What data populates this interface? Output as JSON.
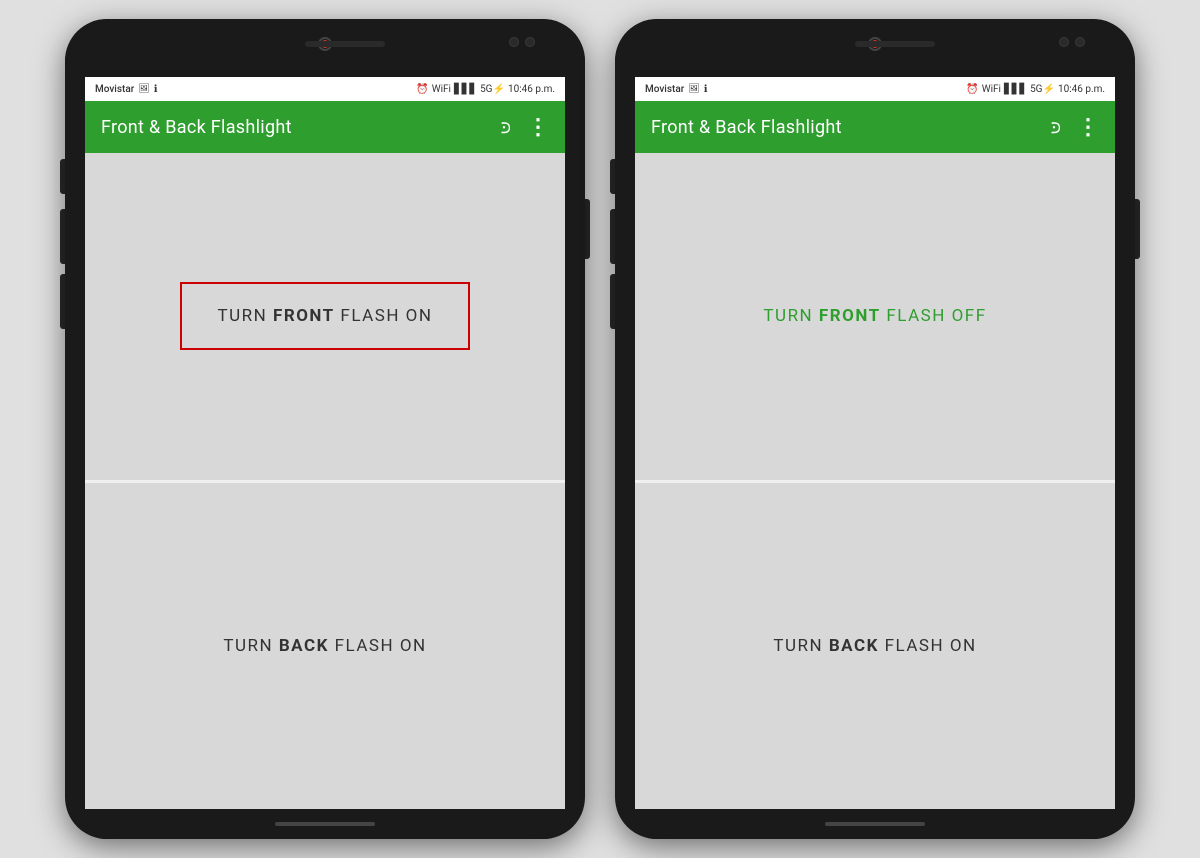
{
  "background_color": "#e0e0e0",
  "phones": [
    {
      "id": "phone-left",
      "carrier": "Movistar",
      "time": "10:46 p.m.",
      "app_title": "Front & Back Flashlight",
      "front_panel": {
        "state": "off",
        "label_normal1": "TURN ",
        "label_bold": "FRONT",
        "label_normal2": " FLASH ON",
        "has_red_border": true,
        "color": "dark"
      },
      "back_panel": {
        "state": "off",
        "label_normal1": "TURN ",
        "label_bold": "BACK",
        "label_normal2": " FLASH ON",
        "has_red_border": false,
        "color": "dark"
      }
    },
    {
      "id": "phone-right",
      "carrier": "Movistar",
      "time": "10:46 p.m.",
      "app_title": "Front & Back Flashlight",
      "front_panel": {
        "state": "on",
        "label_normal1": "TURN ",
        "label_bold": "FRONT",
        "label_normal2": " FLASH OFF",
        "has_red_border": false,
        "color": "green"
      },
      "back_panel": {
        "state": "off",
        "label_normal1": "TURN ",
        "label_bold": "BACK",
        "label_normal2": " FLASH ON",
        "has_red_border": false,
        "color": "dark"
      }
    }
  ],
  "share_icon": "⋈",
  "menu_icon": "⋮",
  "colors": {
    "green": "#2e9e2e",
    "red_border": "#cc0000",
    "dark_text": "#333333",
    "app_bar": "#2e9e2e"
  }
}
